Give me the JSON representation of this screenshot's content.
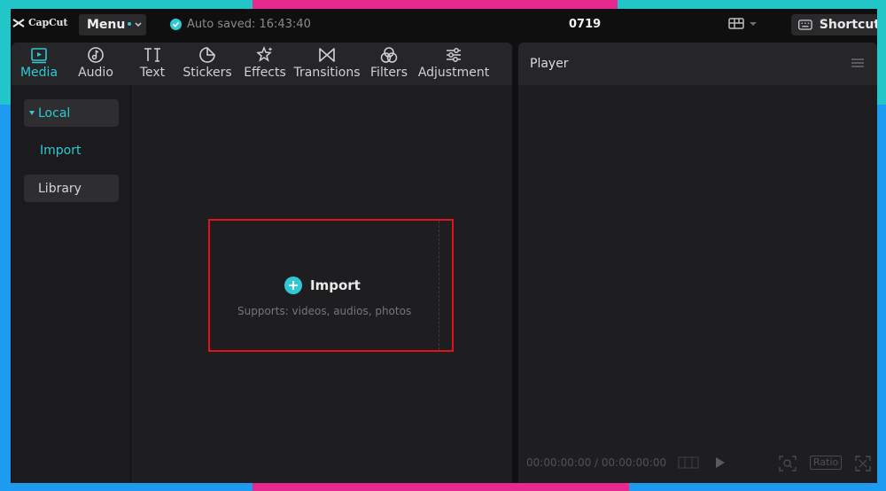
{
  "app": {
    "logo_text": "CapCut",
    "menu_label": "Menu",
    "autosave_text": "Auto saved: 16:43:40",
    "project_title": "0719",
    "shortcut_label": "Shortcut"
  },
  "tabs": [
    {
      "label": "Media",
      "icon": "media-icon",
      "active": true
    },
    {
      "label": "Audio",
      "icon": "audio-icon"
    },
    {
      "label": "Text",
      "icon": "text-icon"
    },
    {
      "label": "Stickers",
      "icon": "stickers-icon"
    },
    {
      "label": "Effects",
      "icon": "effects-icon"
    },
    {
      "label": "Transitions",
      "icon": "transitions-icon"
    },
    {
      "label": "Filters",
      "icon": "filters-icon"
    },
    {
      "label": "Adjustment",
      "icon": "adjustment-icon"
    }
  ],
  "sidebar": {
    "local_label": "Local",
    "import_label": "Import",
    "library_label": "Library"
  },
  "import_zone": {
    "button_label": "Import",
    "hint": "Supports: videos, audios, photos"
  },
  "player": {
    "title": "Player",
    "timecode": "00:00:00:00 / 00:00:00:00",
    "ratio_label": "Ratio"
  },
  "colors": {
    "accent": "#2ec9d4",
    "highlight_border": "#e1121b",
    "frame_teal": "#23c6c8",
    "frame_pink": "#e7298f",
    "frame_blue": "#1d9bf0"
  }
}
